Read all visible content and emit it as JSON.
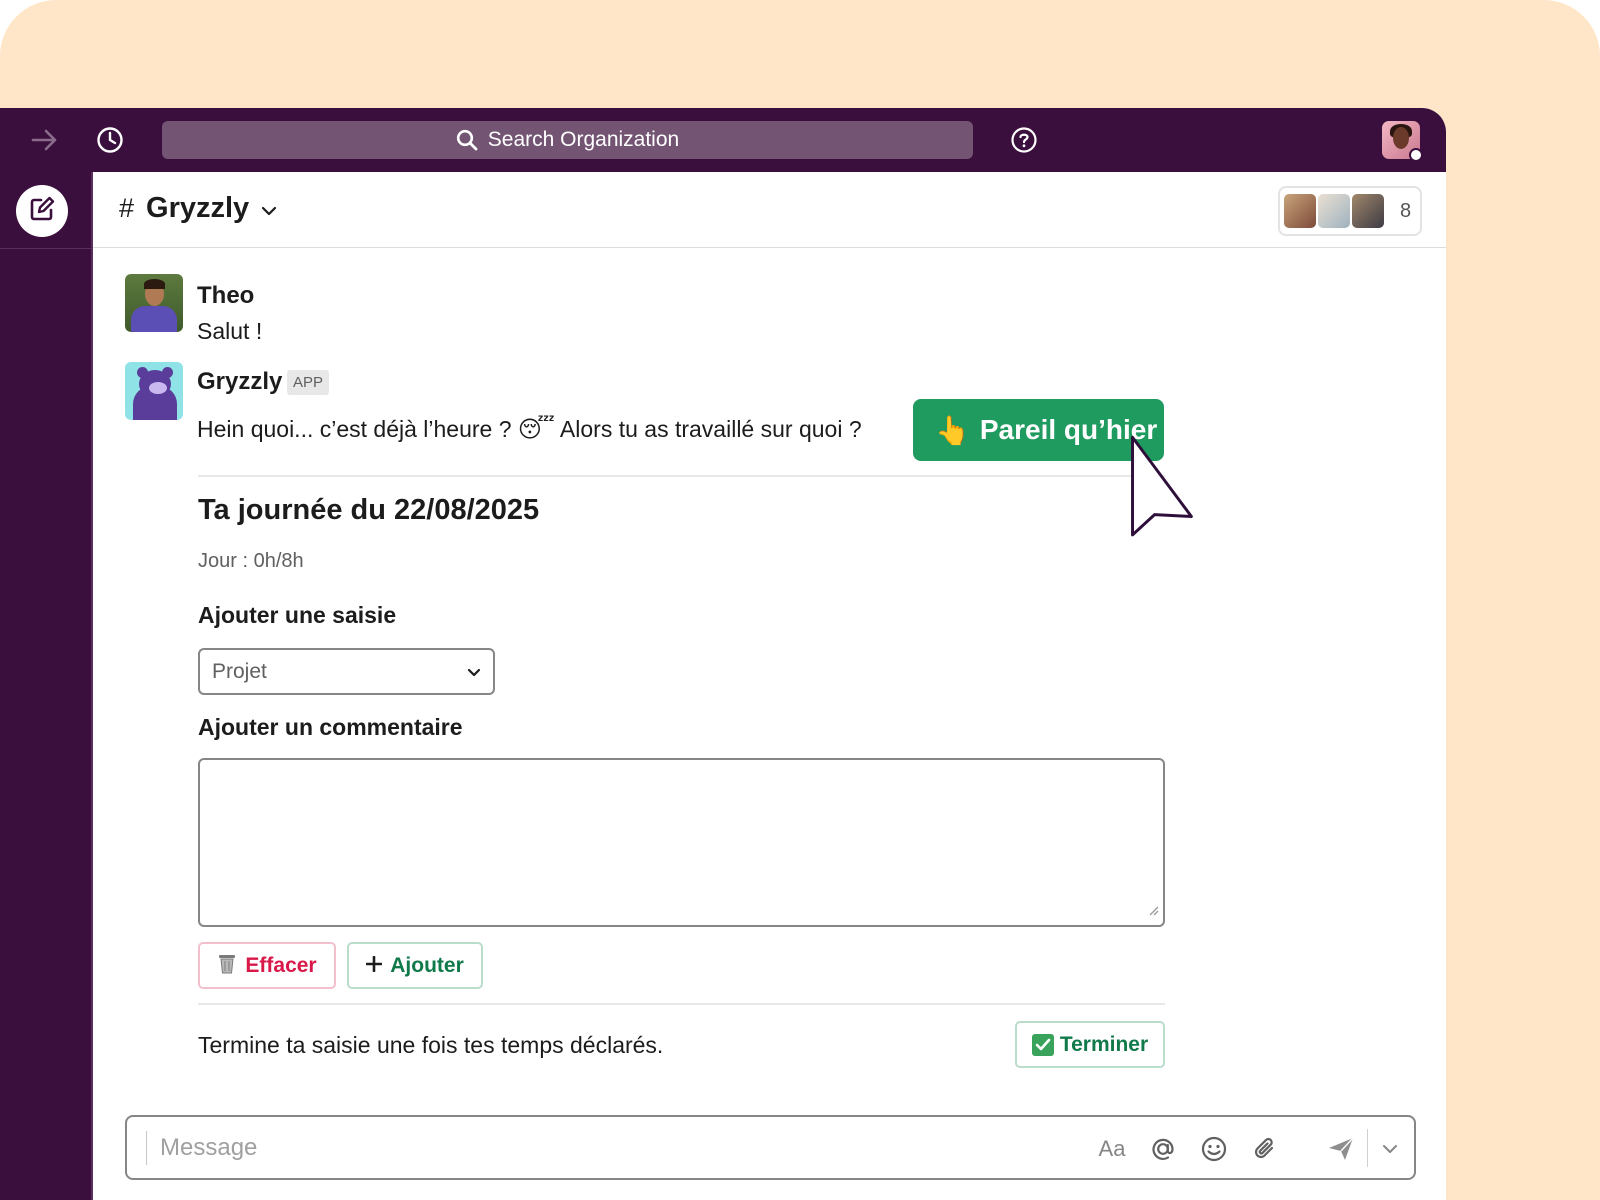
{
  "topbar": {
    "search_placeholder": "Search Organization"
  },
  "channel": {
    "hash": "#",
    "name": "Gryzzly",
    "member_count": "8"
  },
  "messages": [
    {
      "author": "Theo",
      "text": "Salut  !"
    },
    {
      "author": "Gryzzly",
      "badge": "APP",
      "text": "Hein quoi... c’est déjà l’heure ? 😴 Alors tu as travaillé sur quoi ?"
    }
  ],
  "quick_button": {
    "emoji": "👆",
    "label": "Pareil qu’hier"
  },
  "block": {
    "title": "Ta journée du 22/08/2025",
    "day_summary": "Jour : 0h/8h",
    "add_entry_label": "Ajouter une saisie",
    "project_select_value": "Projet",
    "add_comment_label": "Ajouter un commentaire",
    "clear_button": "Effacer",
    "add_button": "Ajouter",
    "footer_text": "Termine ta saisie une fois tes temps déclarés.",
    "finish_button": "Terminer"
  },
  "composer": {
    "placeholder": "Message",
    "format_label": "Aa"
  },
  "colors": {
    "aubergine": "#3b0f3d",
    "peach": "#ffe6c9",
    "green": "#1f9b5f",
    "danger": "#d9184a"
  },
  "icons": [
    "forward-arrow-icon",
    "history-clock-icon",
    "search-icon",
    "help-icon",
    "compose-icon",
    "chevron-down-icon",
    "trash-icon",
    "plus-icon",
    "check-icon",
    "at-icon",
    "emoji-icon",
    "attachment-icon",
    "send-icon",
    "cursor-pointer-icon"
  ]
}
